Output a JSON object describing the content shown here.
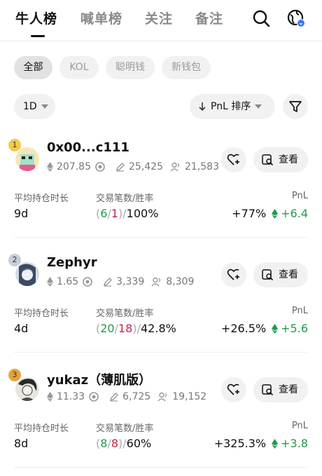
{
  "nav": {
    "tabs": [
      "牛人榜",
      "喊单榜",
      "关注",
      "备注"
    ],
    "active_tab": 0
  },
  "filters": {
    "chips": [
      "全部",
      "KOL",
      "聪明钱",
      "新钱包"
    ],
    "active_chip": 0
  },
  "controls": {
    "timeframe": "1D",
    "sort_label": "PnL 排序"
  },
  "labels": {
    "hold_time": "平均持仓时长",
    "trades_winrate": "交易笔数/胜率",
    "pnl": "PnL",
    "view": "查看"
  },
  "traders": [
    {
      "rank": "1",
      "name": "0x00...c111",
      "eth_balance": "207.85",
      "edit_count": "25,425",
      "followers": "21,583",
      "avg_hold": "9d",
      "trades_buy": "6",
      "trades_sell": "1",
      "win_rate": "100%",
      "pnl_percent": "+77%",
      "pnl_value": "+6.4"
    },
    {
      "rank": "2",
      "name": "Zephyr",
      "eth_balance": "1.65",
      "edit_count": "3,339",
      "followers": "8,309",
      "avg_hold": "4d",
      "trades_buy": "20",
      "trades_sell": "18",
      "win_rate": "42.8%",
      "pnl_percent": "+26.5%",
      "pnl_value": "+5.6"
    },
    {
      "rank": "3",
      "name": "yukaz（薄肌版）",
      "eth_balance": "11.33",
      "edit_count": "6,725",
      "followers": "19,152",
      "avg_hold": "8d",
      "trades_buy": "8",
      "trades_sell": "8",
      "win_rate": "60%",
      "pnl_percent": "+325.3%",
      "pnl_value": "+3.8"
    }
  ],
  "colors": {
    "gain": "#1e9b4b",
    "loss": "#c8244b",
    "rank_1": "#f7c948",
    "rank_2": "#c8cdd8",
    "rank_3": "#e8a33a"
  }
}
